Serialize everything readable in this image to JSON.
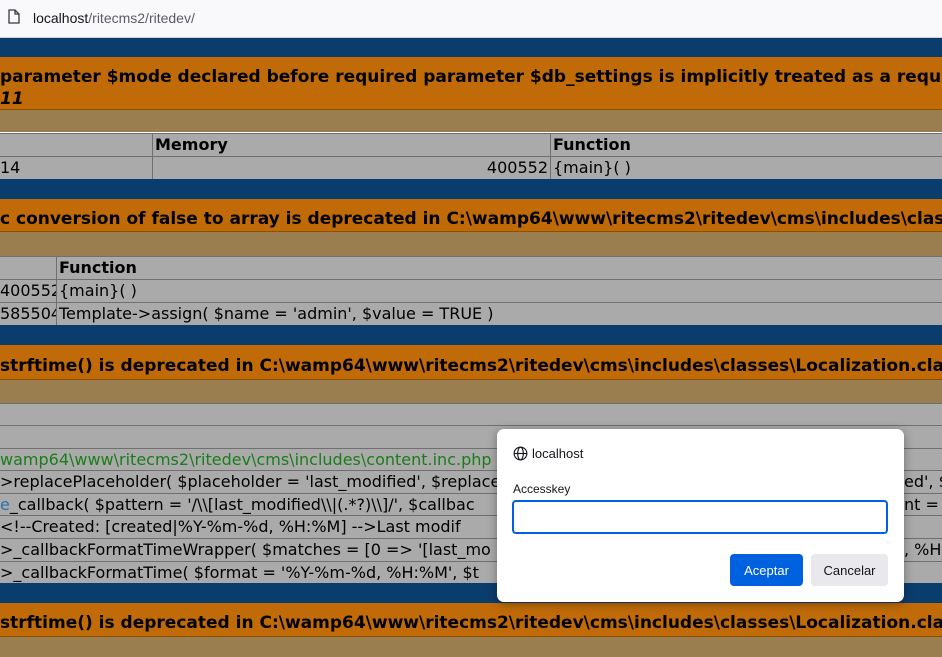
{
  "browser": {
    "url_host": "localhost",
    "url_path": "/ritecms2/ritedev/"
  },
  "errors": {
    "e1": {
      "message": "parameter $mode declared before required parameter $db_settings is implicitly treated as a required par",
      "line": "11",
      "headers": [
        "Memory",
        "Function"
      ],
      "rows": [
        [
          "14",
          "400552",
          "{main}( )"
        ]
      ]
    },
    "e2": {
      "message": "c conversion of false to array is deprecated in C:\\wamp64\\www\\ritecms2\\ritedev\\cms\\includes\\classe",
      "headers": [
        "Function"
      ],
      "rows": [
        [
          "400552",
          "{main}( )"
        ],
        [
          "585504",
          "Template->assign( $name = 'admin', $value = TRUE )"
        ]
      ]
    },
    "e3": {
      "message": "strftime() is deprecated in C:\\wamp64\\www\\ritecms2\\ritedev\\cms\\includes\\classes\\Localization.class",
      "lines": [
        "wamp64\\www\\ritecms2\\ritedev\\cms\\includes\\content.inc.php",
        ">replacePlaceholder( $placeholder = 'last_modified', $replace",
        "_callback( $pattern = '/\\\\[last_modified\\\\|(.*?)\\\\]/', $callbac",
        "<!--Created: [created|%Y-%m-%d, %H:%M] -->Last modif",
        ">_callbackFormatTimeWrapper( $matches = [0 => '[last_mo",
        ">_callbackFormatTime( $format = '%Y-%m-%d, %H:%M', $t"
      ],
      "right_fragments": [
        "ed', $",
        "nt = ",
        ", %H"
      ]
    },
    "e4": {
      "message": "strftime() is deprecated in C:\\wamp64\\www\\ritecms2\\ritedev\\cms\\includes\\classes\\Localization.class"
    }
  },
  "dialog": {
    "host": "localhost",
    "field_label": "Accesskey",
    "field_value": "",
    "accept_label": "Aceptar",
    "cancel_label": "Cancelar"
  },
  "colors": {
    "accent": "#0061e0",
    "error_header": "#c16b08",
    "error_bar": "#0b3c6e"
  }
}
